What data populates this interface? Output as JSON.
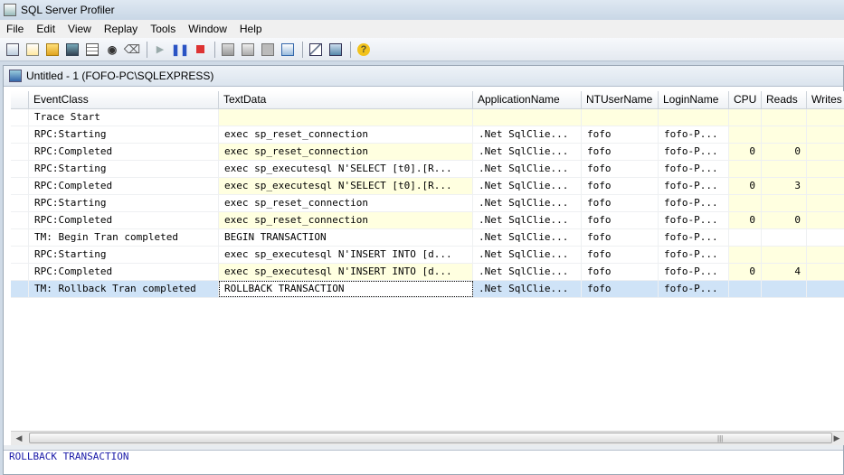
{
  "window": {
    "title": "SQL Server Profiler"
  },
  "menu": [
    "File",
    "Edit",
    "View",
    "Replay",
    "Tools",
    "Window",
    "Help"
  ],
  "toolbar": {
    "icons": [
      "new-trace-icon",
      "new-template-icon",
      "open-icon",
      "save-icon",
      "properties-icon",
      "find-icon",
      "clear-icon",
      "run-icon",
      "pause-icon",
      "stop-icon",
      "trace-properties-icon",
      "template-icon",
      "text-icon",
      "autoscroll-icon",
      "performance-icon",
      "monitor-icon",
      "help-icon"
    ]
  },
  "document": {
    "title": "Untitled - 1 (FOFO-PC\\SQLEXPRESS)"
  },
  "grid": {
    "columns": [
      "",
      "EventClass",
      "TextData",
      "ApplicationName",
      "NTUserName",
      "LoginName",
      "CPU",
      "Reads",
      "Writes"
    ],
    "rows": [
      [
        "",
        "Trace Start",
        "",
        "",
        "",
        "",
        "",
        "",
        ""
      ],
      [
        "",
        "RPC:Starting",
        "exec sp_reset_connection",
        ".Net SqlClie...",
        "fofo",
        "fofo-P...",
        "",
        "",
        ""
      ],
      [
        "",
        "RPC:Completed",
        "exec sp_reset_connection",
        ".Net SqlClie...",
        "fofo",
        "fofo-P...",
        "0",
        "0",
        ""
      ],
      [
        "",
        "RPC:Starting",
        "exec sp_executesql N'SELECT [t0].[R...",
        ".Net SqlClie...",
        "fofo",
        "fofo-P...",
        "",
        "",
        ""
      ],
      [
        "",
        "RPC:Completed",
        "exec sp_executesql N'SELECT [t0].[R...",
        ".Net SqlClie...",
        "fofo",
        "fofo-P...",
        "0",
        "3",
        ""
      ],
      [
        "",
        "RPC:Starting",
        "exec sp_reset_connection",
        ".Net SqlClie...",
        "fofo",
        "fofo-P...",
        "",
        "",
        ""
      ],
      [
        "",
        "RPC:Completed",
        "exec sp_reset_connection",
        ".Net SqlClie...",
        "fofo",
        "fofo-P...",
        "0",
        "0",
        ""
      ],
      [
        "",
        "TM: Begin Tran completed",
        "BEGIN TRANSACTION",
        ".Net SqlClie...",
        "fofo",
        "fofo-P...",
        "",
        "",
        ""
      ],
      [
        "",
        "RPC:Starting",
        "exec sp_executesql N'INSERT INTO [d...",
        ".Net SqlClie...",
        "fofo",
        "fofo-P...",
        "",
        "",
        ""
      ],
      [
        "",
        "RPC:Completed",
        "exec sp_executesql N'INSERT INTO [d...",
        ".Net SqlClie...",
        "fofo",
        "fofo-P...",
        "0",
        "4",
        ""
      ],
      [
        "",
        "TM: Rollback Tran completed",
        "ROLLBACK TRANSACTION",
        ".Net SqlClie...",
        "fofo",
        "fofo-P...",
        "",
        "",
        ""
      ]
    ],
    "highlight_rows": [
      0,
      2,
      4,
      6,
      9
    ],
    "selected_row": 10
  },
  "details": {
    "text": "ROLLBACK TRANSACTION"
  }
}
